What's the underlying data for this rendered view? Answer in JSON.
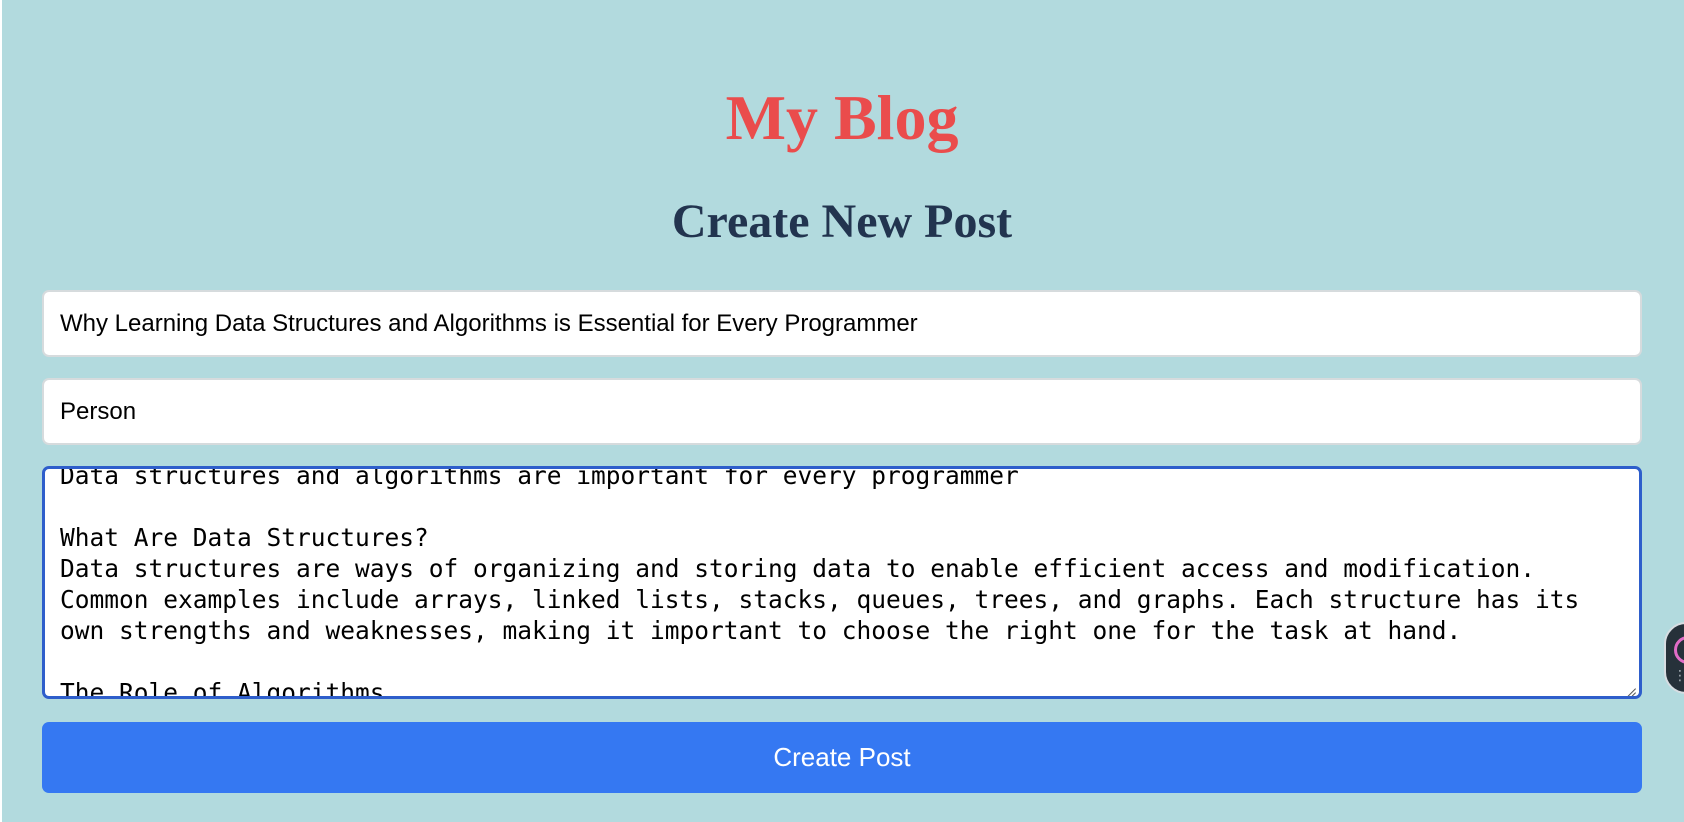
{
  "app": {
    "blog_title": "My Blog",
    "page_title": "Create New Post"
  },
  "form": {
    "title_value": "Why Learning Data Structures and Algorithms is Essential for Every Programmer",
    "author_value": "Person",
    "content_value": "Data structures and algorithms are important for every programmer\n\nWhat Are Data Structures?\nData structures are ways of organizing and storing data to enable efficient access and modification. Common examples include arrays, linked lists, stacks, queues, trees, and graphs. Each structure has its own strengths and weaknesses, making it important to choose the right one for the task at hand.\n\nThe Role of Algorithms",
    "submit_label": "Create Post"
  },
  "extension": {
    "icon": "extension-launcher-icon"
  },
  "colors": {
    "background": "#b2dade",
    "blog_title": "#ea4c4c",
    "page_title": "#22344f",
    "accent": "#3578f2",
    "focus_border": "#2e5ecb"
  }
}
